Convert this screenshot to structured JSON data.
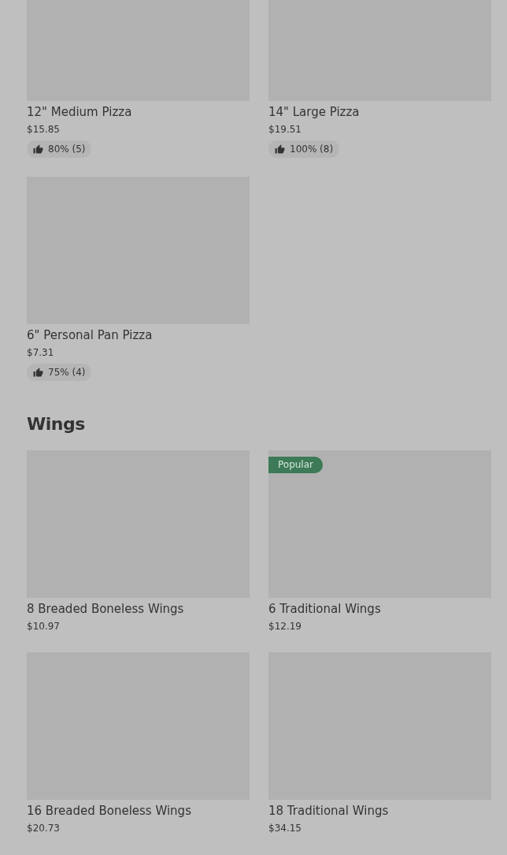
{
  "sections": [
    {
      "rows": [
        [
          {
            "image": {
              "kind": "placeholder"
            },
            "name": "12\" Medium Pizza",
            "price": "$15.85",
            "rating": "80% (5)"
          },
          {
            "image": {
              "kind": "placeholder"
            },
            "name": "14\" Large Pizza",
            "price": "$19.51",
            "rating": "100% (8)"
          }
        ],
        [
          {
            "image": {
              "kind": "placeholder"
            },
            "name": "6\" Personal Pan Pizza",
            "price": "$7.31",
            "rating": "75% (4)"
          }
        ]
      ]
    },
    {
      "title": "Wings",
      "rows": [
        [
          {
            "image": {
              "kind": "placeholder"
            },
            "name": "8 Breaded Boneless Wings",
            "price": "$10.97"
          },
          {
            "image": {
              "kind": "placeholder"
            },
            "badge": "Popular",
            "name": "6 Traditional Wings",
            "price": "$12.19"
          }
        ],
        [
          {
            "image": {
              "kind": "placeholder"
            },
            "name": "16 Breaded Boneless Wings",
            "price": "$20.73"
          },
          {
            "image": {
              "kind": "placeholder"
            },
            "name": "18 Traditional Wings",
            "price": "$34.15"
          }
        ]
      ]
    }
  ]
}
